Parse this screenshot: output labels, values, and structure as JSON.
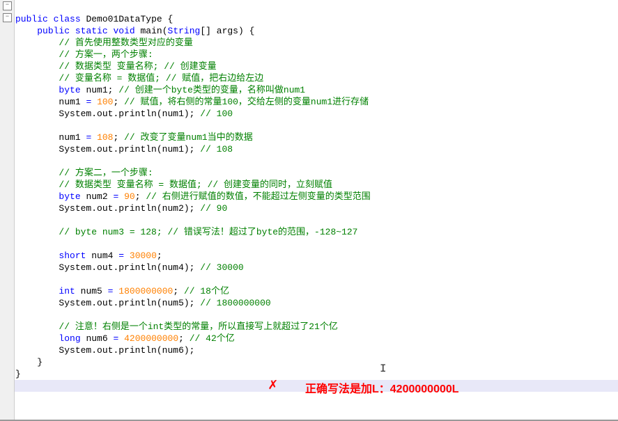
{
  "code": {
    "l1_kw1": "public",
    "l1_kw2": "class",
    "l1_cls": "Demo01DataType",
    "l1_brace": "{",
    "l2_kw1": "public",
    "l2_kw2": "static",
    "l2_kw3": "void",
    "l2_m": "main",
    "l2_p1": "(",
    "l2_t": "String",
    "l2_arr": "[]",
    "l2_a": "args",
    "l2_p2": ")",
    "l2_brace": "{",
    "l3": "// 首先使用整数类型对应的变量",
    "l4": "// 方案一，两个步骤:",
    "l5": "// 数据类型 变量名称; // 创建变量",
    "l6": "// 变量名称 = 数据值; // 赋值，把右边给左边",
    "l7_t": "byte",
    "l7_v": "num1",
    "l7_s": ";",
    "l7_c": "// 创建一个byte类型的变量，名称叫做num1",
    "l8_v": "num1",
    "l8_eq": "=",
    "l8_n": "100",
    "l8_s": ";",
    "l8_c": "// 赋值，将右侧的常量100，交给左侧的变量num1进行存储",
    "l9_a": "System",
    "l9_b": ".out.",
    "l9_m": "println",
    "l9_p": "(num1);",
    "l9_c": "// 100",
    "l11_v": "num1",
    "l11_eq": "=",
    "l11_n": "108",
    "l11_s": ";",
    "l11_c": "// 改变了变量num1当中的数据",
    "l12_a": "System",
    "l12_b": ".out.",
    "l12_m": "println",
    "l12_p": "(num1);",
    "l12_c": "// 108",
    "l14": "// 方案二，一个步骤:",
    "l15": "// 数据类型 变量名称 = 数据值; // 创建变量的同时，立刻赋值",
    "l16_t": "byte",
    "l16_v": "num2",
    "l16_eq": "=",
    "l16_n": "90",
    "l16_s": ";",
    "l16_c": "// 右侧进行赋值的数值，不能超过左侧变量的类型范围",
    "l17_a": "System",
    "l17_b": ".out.",
    "l17_m": "println",
    "l17_p": "(num2);",
    "l17_c": "// 90",
    "l19": "// byte num3 = 128; // 错误写法！超过了byte的范围，-128~127",
    "l21_t": "short",
    "l21_v": "num4",
    "l21_eq": "=",
    "l21_n": "30000",
    "l21_s": ";",
    "l22_a": "System",
    "l22_b": ".out.",
    "l22_m": "println",
    "l22_p": "(num4);",
    "l22_c": "// 30000",
    "l24_t": "int",
    "l24_v": "num5",
    "l24_eq": "=",
    "l24_n": "1800000000",
    "l24_s": ";",
    "l24_c": "// 18个亿",
    "l25_a": "System",
    "l25_b": ".out.",
    "l25_m": "println",
    "l25_p": "(num5);",
    "l25_c": "// 1800000000",
    "l27": "// 注意！右侧是一个int类型的常量，所以直接写上就超过了21个亿",
    "l28_t": "long",
    "l28_v": "num6",
    "l28_eq": "=",
    "l28_n": "4200000000",
    "l28_s": ";",
    "l28_c": "// 42个亿",
    "l29_a": "System",
    "l29_b": ".out.",
    "l29_m": "println",
    "l29_p": "(num6);",
    "l30": "}",
    "l31": "}"
  },
  "annotation": {
    "x_mark": "✗",
    "note": "正确写法是加L：4200000000L"
  }
}
